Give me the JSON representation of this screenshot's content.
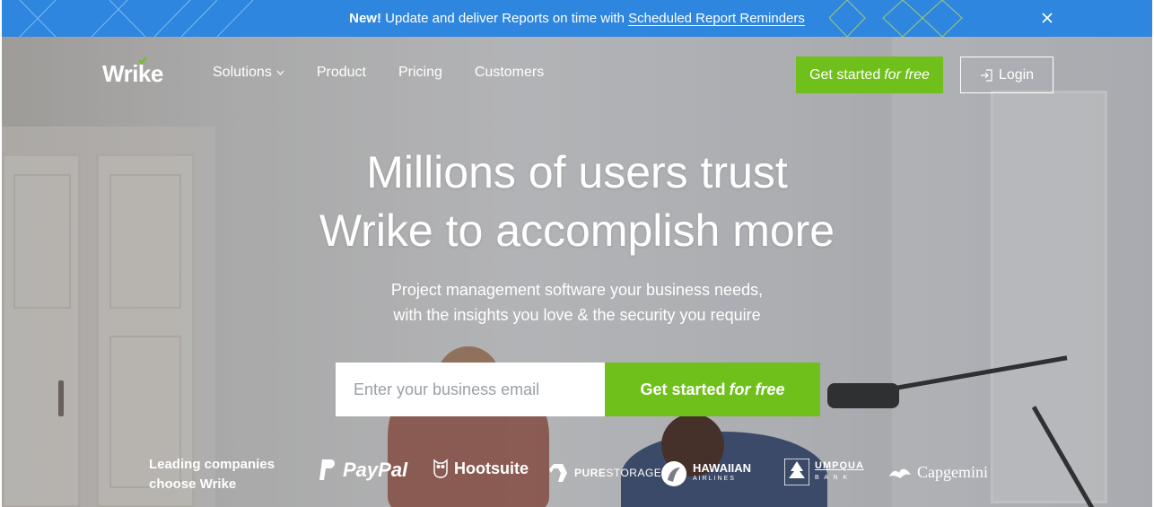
{
  "announcement": {
    "new_label": "New!",
    "message": "Update and deliver Reports on time with",
    "link_text": "Scheduled Report Reminders",
    "close_icon": "close-icon",
    "background_color": "#2f86de"
  },
  "nav": {
    "logo": "Wrike",
    "links": [
      "Solutions",
      "Product",
      "Pricing",
      "Customers"
    ],
    "cta_label": "Get started",
    "cta_suffix": "for free",
    "login_label": "Login",
    "login_icon": "login-icon",
    "accent_color": "#6fc01b"
  },
  "hero": {
    "headline_line1": "Millions of users trust",
    "headline_line2": "Wrike to accomplish more",
    "subhead_line1": "Project management software your business needs,",
    "subhead_line2": "with the insights you love & the security you require",
    "email_placeholder": "Enter your business email",
    "cta_label": "Get started",
    "cta_suffix": "for free"
  },
  "customers": {
    "label_line1": "Leading companies",
    "label_line2": "choose Wrike",
    "logos": {
      "paypal": "PayPal",
      "hootsuite": "Hootsuite",
      "pure_bold": "PURE",
      "pure_rest": "STORAGE",
      "hawaiian": "HAWAIIAN",
      "hawaiian_sub": "AIRLINES",
      "umpqua": "UMPQUA",
      "umpqua_sub": "B A N K",
      "capgemini": "Capgemini"
    }
  }
}
